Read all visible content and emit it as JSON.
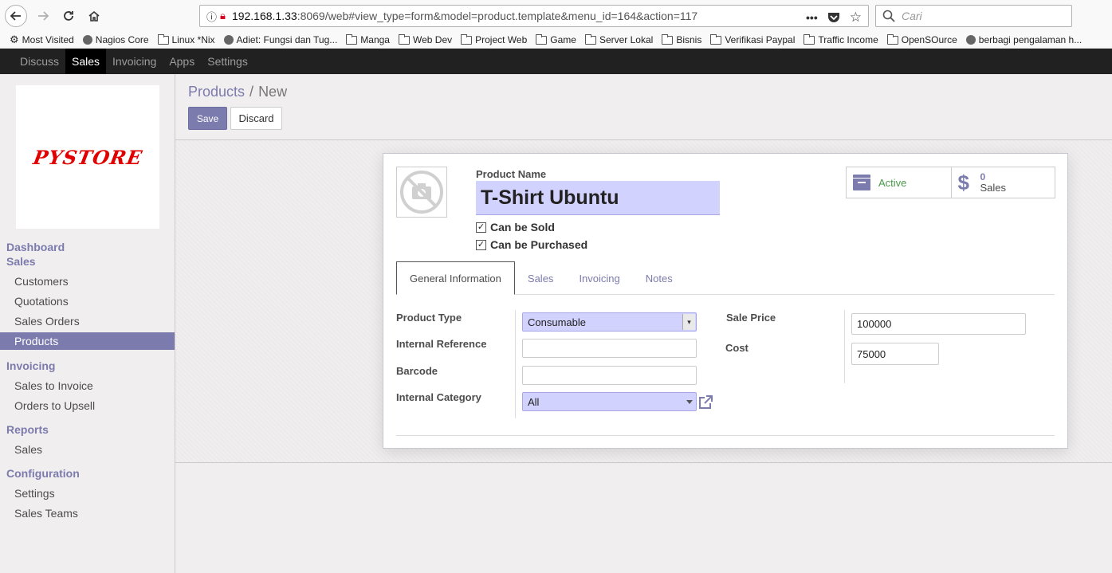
{
  "browser": {
    "url_host": "192.168.1.33",
    "url_rest": ":8069/web#view_type=form&model=product.template&menu_id=164&action=117",
    "search_placeholder": "Cari",
    "bookmarks": [
      {
        "label": "Most Visited",
        "icon": "gear-icon"
      },
      {
        "label": "Nagios Core",
        "icon": "globe-icon"
      },
      {
        "label": "Linux *Nix",
        "icon": "folder-icon"
      },
      {
        "label": "Adiet: Fungsi dan Tug...",
        "icon": "globe-icon"
      },
      {
        "label": "Manga",
        "icon": "folder-icon"
      },
      {
        "label": "Web Dev",
        "icon": "folder-icon"
      },
      {
        "label": "Project Web",
        "icon": "folder-icon"
      },
      {
        "label": "Game",
        "icon": "folder-icon"
      },
      {
        "label": "Server Lokal",
        "icon": "folder-icon"
      },
      {
        "label": "Bisnis",
        "icon": "folder-icon"
      },
      {
        "label": "Verifikasi Paypal",
        "icon": "folder-icon"
      },
      {
        "label": "Traffic Income",
        "icon": "folder-icon"
      },
      {
        "label": "OpenSOurce",
        "icon": "folder-icon"
      },
      {
        "label": "berbagi pengalaman h...",
        "icon": "globe-icon"
      }
    ]
  },
  "topbar": {
    "menus": [
      "Discuss",
      "Sales",
      "Invoicing",
      "Apps",
      "Settings"
    ],
    "active": "Sales"
  },
  "sidebar": {
    "logo_text": "PYSTORE",
    "sections": {
      "dashboard": "Dashboard",
      "sales": "Sales",
      "invoicing": "Invoicing",
      "reports": "Reports",
      "configuration": "Configuration"
    },
    "items": {
      "customers": "Customers",
      "quotations": "Quotations",
      "sales_orders": "Sales Orders",
      "products": "Products",
      "sales_to_invoice": "Sales to Invoice",
      "orders_to_upsell": "Orders to Upsell",
      "report_sales": "Sales",
      "settings": "Settings",
      "sales_teams": "Sales Teams"
    }
  },
  "control_panel": {
    "breadcrumb_parent": "Products",
    "breadcrumb_sep": "/",
    "breadcrumb_current": "New",
    "save_label": "Save",
    "discard_label": "Discard"
  },
  "form": {
    "product_name_label": "Product Name",
    "product_name": "T-Shirt Ubuntu",
    "can_be_sold": "Can be Sold",
    "can_be_purchased": "Can be Purchased",
    "smart_active": "Active",
    "smart_sales_count": "0",
    "smart_sales_label": "Sales",
    "tabs": [
      "General Information",
      "Sales",
      "Invoicing",
      "Notes"
    ],
    "fields": {
      "product_type_label": "Product Type",
      "product_type_value": "Consumable",
      "internal_reference_label": "Internal Reference",
      "internal_reference_value": "",
      "barcode_label": "Barcode",
      "barcode_value": "",
      "internal_category_label": "Internal Category",
      "internal_category_value": "All",
      "sale_price_label": "Sale Price",
      "sale_price_value": "100000",
      "cost_label": "Cost",
      "cost_value": "75000"
    }
  },
  "colors": {
    "accent": "#7c7bad",
    "required_bg": "#d2d2ff",
    "topbar_bg": "#212121",
    "logo_red": "#e00000"
  }
}
